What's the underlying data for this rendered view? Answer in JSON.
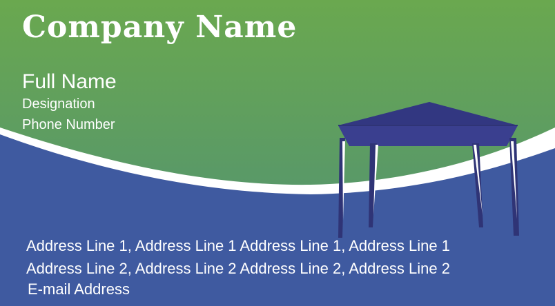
{
  "card": {
    "company_name": "Company Name",
    "full_name": "Full Name",
    "designation": "Designation",
    "phone": "Phone Number",
    "address_line_1": "Address Line 1,  Address Line 1 Address Line 1,  Address Line 1",
    "address_line_2": "Address Line 2,  Address Line 2 Address Line 2,  Address Line 2",
    "email": "E-mail Address"
  },
  "colors": {
    "green_top": "#6aa84f",
    "green_bottom": "#4e8f78",
    "blue": "#3f5aa0",
    "tent": "#3a3f8f",
    "white": "#ffffff"
  },
  "icons": [
    "gazebo-tent-illustration"
  ]
}
